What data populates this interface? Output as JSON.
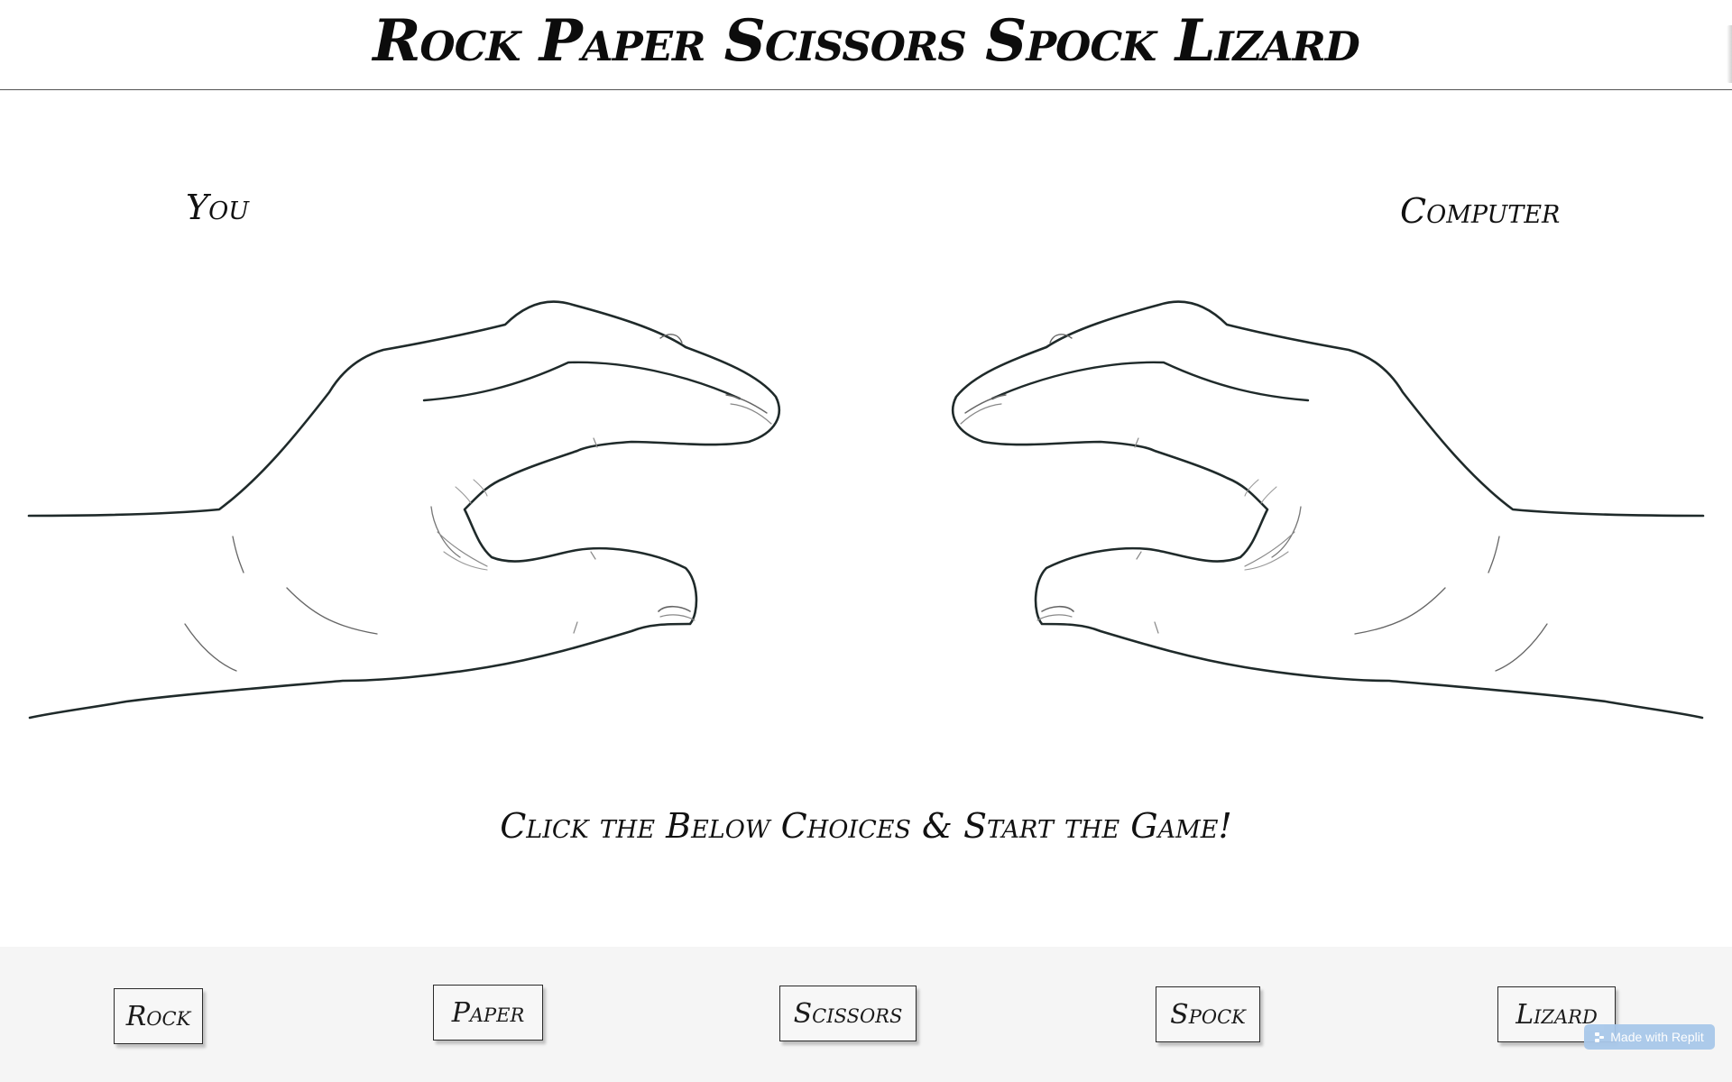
{
  "header": {
    "title": "Rock Paper Scissors Spock Lizard"
  },
  "players": {
    "you_label": "You",
    "computer_label": "Computer"
  },
  "hands": {
    "you": "rock-hand-drawing",
    "computer": "rock-hand-drawing"
  },
  "instruction": "Click the Below Choices & Start the Game!",
  "choices": [
    {
      "label": "Rock"
    },
    {
      "label": "Paper"
    },
    {
      "label": "Scissors"
    },
    {
      "label": "Spock"
    },
    {
      "label": "Lizard"
    }
  ],
  "badge": {
    "label": "Made with Replit",
    "icon": "replit-icon",
    "color": "#a9c8ea"
  },
  "colors": {
    "ink": "#111111",
    "footer_bg": "#f5f5f5",
    "divider": "#555555"
  }
}
